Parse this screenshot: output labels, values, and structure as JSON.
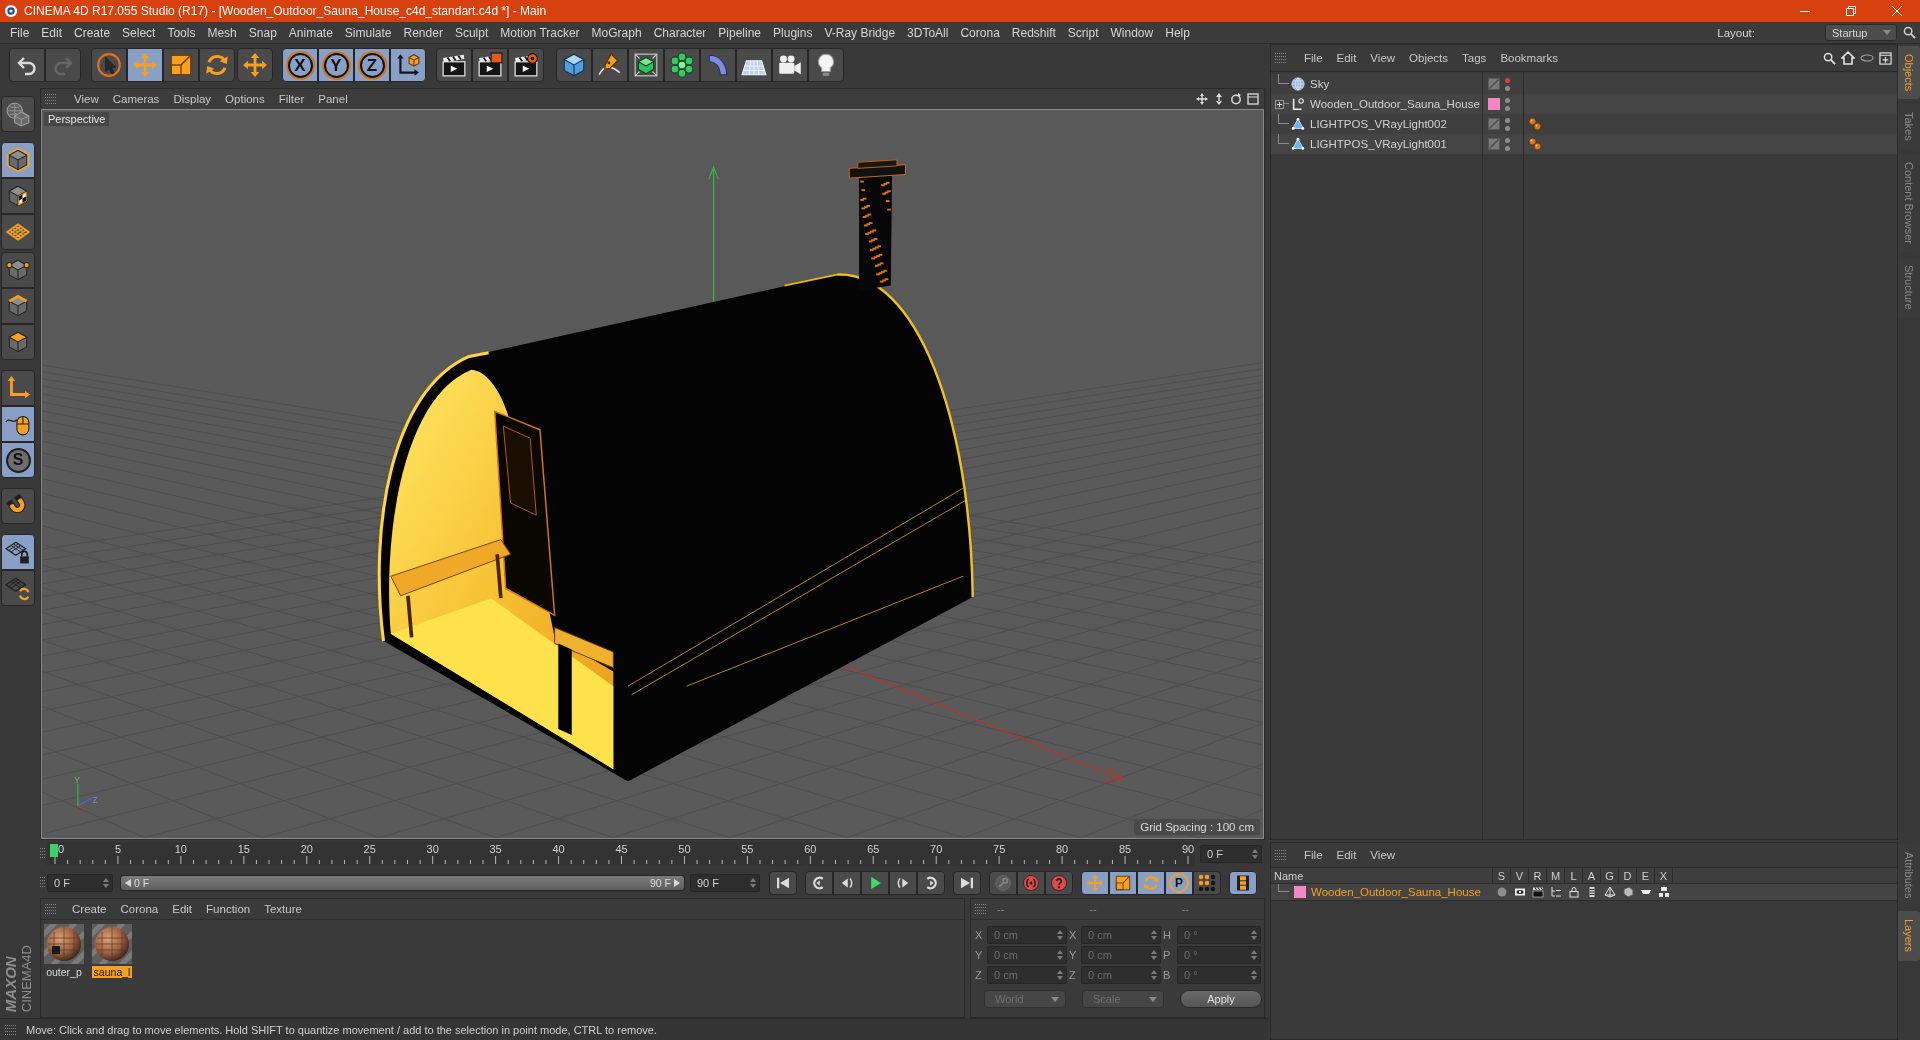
{
  "window": {
    "title": "CINEMA 4D R17.055 Studio (R17) - [Wooden_Outdoor_Sauna_House_c4d_standart.c4d *] - Main"
  },
  "menu_bar": {
    "items": [
      "File",
      "Edit",
      "Create",
      "Select",
      "Tools",
      "Mesh",
      "Snap",
      "Animate",
      "Simulate",
      "Render",
      "Sculpt",
      "Motion Tracker",
      "MoGraph",
      "Character",
      "Pipeline",
      "Plugins",
      "V-Ray Bridge",
      "3DToAll",
      "Corona",
      "Redshift",
      "Script",
      "Window",
      "Help"
    ],
    "layout_label": "Layout:",
    "layout_value": "Startup"
  },
  "toolbar": {
    "history": [
      {
        "kind": "undo",
        "disabled": false
      },
      {
        "kind": "redo",
        "disabled": true
      }
    ],
    "groups": [
      [
        {
          "kind": "select",
          "selected": false
        },
        {
          "kind": "move",
          "selected": true
        },
        {
          "kind": "scale",
          "selected": false
        },
        {
          "kind": "rotate",
          "selected": false
        }
      ],
      [
        {
          "kind": "move",
          "selected": false
        }
      ],
      [
        {
          "kind": "axis_lock",
          "label": "X",
          "selected": true
        },
        {
          "kind": "axis_lock",
          "label": "Y",
          "selected": true
        },
        {
          "kind": "axis_lock",
          "label": "Z",
          "selected": true
        },
        {
          "kind": "coordsys",
          "selected": true
        }
      ],
      [
        {
          "kind": "render_view",
          "selected": false
        },
        {
          "kind": "render_picture",
          "selected": false
        },
        {
          "kind": "render_settings",
          "selected": false
        }
      ],
      [
        {
          "kind": "cube",
          "selected": false
        },
        {
          "kind": "pen",
          "selected": false
        },
        {
          "kind": "subdivision",
          "selected": false
        },
        {
          "kind": "cloner",
          "selected": false
        },
        {
          "kind": "deformer",
          "selected": false
        },
        {
          "kind": "floor",
          "selected": false
        },
        {
          "kind": "camera",
          "selected": false
        },
        {
          "kind": "light",
          "selected": false
        }
      ]
    ]
  },
  "mode_bar": {
    "groups": [
      [
        {
          "kind": "globe",
          "selected": false
        }
      ],
      [
        {
          "kind": "model",
          "selected": true
        },
        {
          "kind": "texture",
          "selected": false
        },
        {
          "kind": "workplane",
          "selected": false
        }
      ],
      [
        {
          "kind": "points",
          "selected": false
        },
        {
          "kind": "edges",
          "selected": false
        },
        {
          "kind": "polygons",
          "selected": false
        }
      ],
      [
        {
          "kind": "axis_mode",
          "selected": false
        },
        {
          "kind": "tweak",
          "selected": true
        },
        {
          "kind": "snap",
          "label": "S",
          "selected": true
        }
      ],
      [
        {
          "kind": "magnet",
          "selected": false
        }
      ],
      [
        {
          "kind": "workplane_lock",
          "selected": true
        },
        {
          "kind": "workplane_sync",
          "selected": false
        }
      ]
    ]
  },
  "viewport": {
    "menus": [
      "View",
      "Cameras",
      "Display",
      "Options",
      "Filter",
      "Panel"
    ],
    "camera": "Perspective",
    "grid_spacing": "Grid Spacing : 100 cm",
    "gizmo_labels": [
      "Y",
      "Z"
    ]
  },
  "timeline": {
    "ticks": [
      "0",
      "5",
      "10",
      "15",
      "20",
      "25",
      "30",
      "35",
      "40",
      "45",
      "50",
      "55",
      "60",
      "65",
      "70",
      "75",
      "80",
      "85",
      "90"
    ],
    "level": 0,
    "current_frame": "0 F"
  },
  "transport": {
    "start_frame": "0 F",
    "range_slider": {
      "level": 1,
      "start": "0 F",
      "end": "90 F"
    },
    "end_frame": "90 F",
    "groups": [
      [
        {
          "kind": "first",
          "selected": false
        }
      ],
      [
        {
          "kind": "prev_key",
          "selected": false
        },
        {
          "kind": "prev_frame",
          "selected": false
        },
        {
          "kind": "play",
          "selected": false
        },
        {
          "kind": "next_frame",
          "selected": false
        },
        {
          "kind": "next_key",
          "selected": false
        }
      ],
      [
        {
          "kind": "last",
          "selected": false
        }
      ],
      [
        {
          "kind": "keys",
          "selected": false
        },
        {
          "kind": "record",
          "selected": false
        },
        {
          "kind": "autokey",
          "selected": false
        }
      ],
      [
        {
          "kind": "key_move",
          "selected": true
        },
        {
          "kind": "key_scale",
          "selected": true
        },
        {
          "kind": "key_rotate",
          "selected": true
        },
        {
          "kind": "key_param",
          "label": "P",
          "selected": true
        },
        {
          "kind": "key_points",
          "selected": false
        }
      ],
      [
        {
          "kind": "timeline",
          "selected": true
        }
      ]
    ]
  },
  "material_manager": {
    "menus": [
      "Create",
      "Corona",
      "Edit",
      "Function",
      "Texture"
    ],
    "materials": [
      {
        "name": "outer_p",
        "selected": false
      },
      {
        "name": "sauna_l",
        "selected": true
      }
    ]
  },
  "coordinates": {
    "disabled": true,
    "headers": [
      "--",
      "--",
      "--"
    ],
    "rows": [
      {
        "cells": [
          {
            "label": "X",
            "value": "0 cm"
          },
          {
            "label": "X",
            "value": "0 cm"
          },
          {
            "label": "H",
            "value": "0 °"
          }
        ]
      },
      {
        "cells": [
          {
            "label": "Y",
            "value": "0 cm"
          },
          {
            "label": "Y",
            "value": "0 cm"
          },
          {
            "label": "P",
            "value": "0 °"
          }
        ]
      },
      {
        "cells": [
          {
            "label": "Z",
            "value": "0 cm"
          },
          {
            "label": "Z",
            "value": "0 cm"
          },
          {
            "label": "B",
            "value": "0 °"
          }
        ]
      }
    ],
    "mode": "World",
    "transform": "Scale",
    "apply": "Apply"
  },
  "logo": {
    "brand": "MAXON",
    "product": "CINEMA4D"
  },
  "status_bar": {
    "text": "Move: Click and drag to move elements. Hold SHIFT to quantize movement / add to the selection in point mode, CTRL to remove."
  },
  "object_manager": {
    "menus": [
      "File",
      "Edit",
      "View",
      "Objects",
      "Tags",
      "Bookmarks"
    ],
    "objects": [
      {
        "name": "Sky",
        "kind": "sky",
        "editor_hidden": true,
        "has_tag": false
      },
      {
        "name": "Wooden_Outdoor_Sauna_House",
        "kind": "null",
        "color": "#f387c3",
        "expanded": false,
        "editor_hidden": false,
        "has_tag": false
      },
      {
        "name": "LIGHTPOS_VRayLight002",
        "kind": "light",
        "editor_hidden": false,
        "has_tag": true
      },
      {
        "name": "LIGHTPOS_VRayLight001",
        "kind": "light",
        "editor_hidden": false,
        "has_tag": true
      }
    ]
  },
  "layer_manager": {
    "menus": [
      "File",
      "Edit",
      "View"
    ],
    "columns": [
      "Name",
      "S",
      "V",
      "R",
      "M",
      "L",
      "A",
      "G",
      "D",
      "E",
      "X"
    ],
    "layers": [
      {
        "name": "Wooden_Outdoor_Sauna_House",
        "color": "#f387c3",
        "selected": true
      }
    ]
  },
  "side_tabs": {
    "top": [
      {
        "label": "Objects",
        "selected": true
      },
      {
        "label": "Takes",
        "selected": false
      },
      {
        "label": "Content Browser",
        "selected": false
      },
      {
        "label": "Structure",
        "selected": false
      }
    ],
    "bottom": [
      {
        "label": "Attributes",
        "selected": false
      },
      {
        "label": "Layers",
        "selected": true
      }
    ]
  }
}
